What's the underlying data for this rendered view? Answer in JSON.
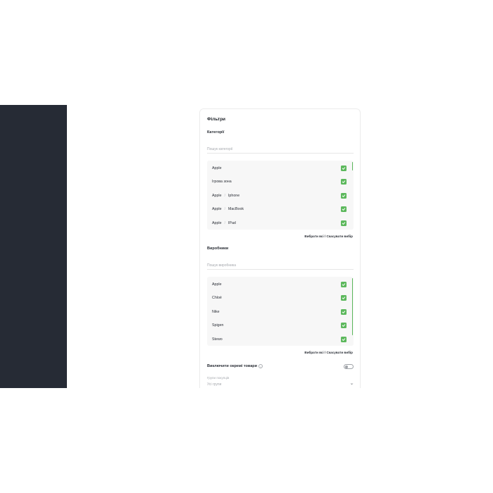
{
  "filters": {
    "title": "Фільтри",
    "categories": {
      "label": "Категорії",
      "search_placeholder": "Пошук категорії",
      "items": [
        {
          "parts": [
            "Apple"
          ],
          "checked": true
        },
        {
          "parts": [
            "Ігрова зона"
          ],
          "checked": true
        },
        {
          "parts": [
            "Apple",
            "Iphone"
          ],
          "checked": true
        },
        {
          "parts": [
            "Apple",
            "MacBook"
          ],
          "checked": true
        },
        {
          "parts": [
            "Apple",
            "IPad"
          ],
          "checked": true
        }
      ],
      "separator": "/",
      "select_all": "Вибрати всі",
      "link_separator": " / ",
      "deselect": "Скасувати вибір"
    },
    "manufacturers": {
      "label": "Виробники",
      "search_placeholder": "Пошук виробника",
      "items": [
        {
          "parts": [
            "Apple"
          ],
          "checked": true
        },
        {
          "parts": [
            "Chloé"
          ],
          "checked": true
        },
        {
          "parts": [
            "Nike"
          ],
          "checked": true
        },
        {
          "parts": [
            "Spigen"
          ],
          "checked": true
        },
        {
          "parts": [
            "Stewo"
          ],
          "checked": true
        }
      ],
      "select_all": "Вибрати всі",
      "link_separator": " / ",
      "deselect": "Скасувати вибір"
    },
    "exclude": {
      "label": "Виключити окремі товари",
      "info_glyph": "i",
      "enabled": false
    },
    "buyer_groups": {
      "label": "Групи покупців",
      "value": "Усі групи"
    }
  },
  "colors": {
    "sidebar": "#262b35",
    "accent_green": "#5cb85c"
  }
}
